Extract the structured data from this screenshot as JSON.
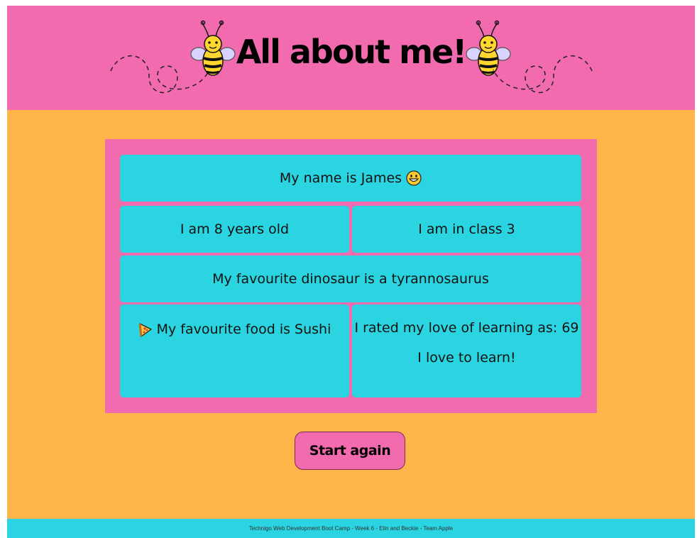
{
  "header": {
    "title": "All about me!",
    "background_color": "#f26bae",
    "decorations": [
      "bee-icon",
      "bee-icon",
      "dashed-trail"
    ]
  },
  "summary": {
    "name_text": "My name is James",
    "name_emoji": "grinning-face-icon",
    "age_text": "I am 8 years old",
    "class_text": "I am in class 3",
    "dinosaur_text": "My favourite dinosaur is a tyrannosaurus",
    "food_icon": "pizza-icon",
    "food_text": "My favourite food is Sushi",
    "rating_text": "I rated my love of learning as: 69",
    "learn_text": "I love to learn!"
  },
  "actions": {
    "restart_label": "Start again"
  },
  "footer": {
    "text": "Technigo Web Development Boot Camp - Week 6 - Elin and Beckie - Team Apple"
  },
  "colors": {
    "pink": "#f26bae",
    "orange": "#ffb54a",
    "cyan": "#2ad4e0"
  }
}
